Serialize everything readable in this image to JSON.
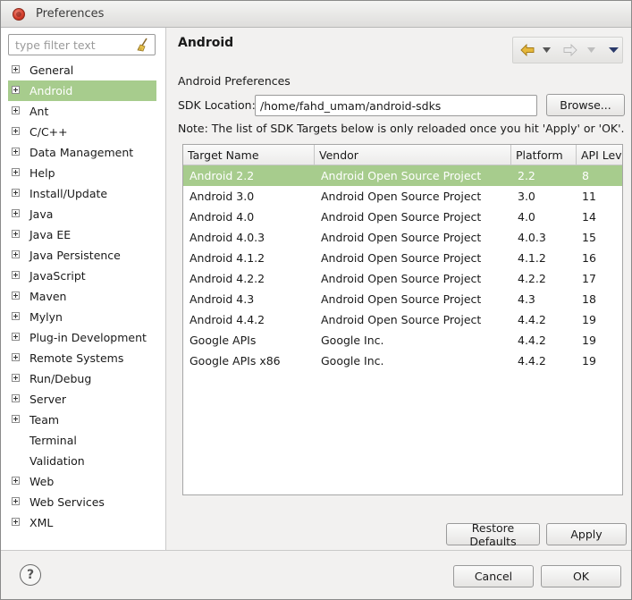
{
  "window": {
    "title": "Preferences"
  },
  "filter": {
    "placeholder": "type filter text"
  },
  "tree": [
    {
      "label": "General",
      "expandable": true
    },
    {
      "label": "Android",
      "expandable": true,
      "selected": true
    },
    {
      "label": "Ant",
      "expandable": true
    },
    {
      "label": "C/C++",
      "expandable": true
    },
    {
      "label": "Data Management",
      "expandable": true
    },
    {
      "label": "Help",
      "expandable": true
    },
    {
      "label": "Install/Update",
      "expandable": true
    },
    {
      "label": "Java",
      "expandable": true
    },
    {
      "label": "Java EE",
      "expandable": true
    },
    {
      "label": "Java Persistence",
      "expandable": true
    },
    {
      "label": "JavaScript",
      "expandable": true
    },
    {
      "label": "Maven",
      "expandable": true
    },
    {
      "label": "Mylyn",
      "expandable": true
    },
    {
      "label": "Plug-in Development",
      "expandable": true
    },
    {
      "label": "Remote Systems",
      "expandable": true
    },
    {
      "label": "Run/Debug",
      "expandable": true
    },
    {
      "label": "Server",
      "expandable": true
    },
    {
      "label": "Team",
      "expandable": true
    },
    {
      "label": "Terminal",
      "expandable": false
    },
    {
      "label": "Validation",
      "expandable": false
    },
    {
      "label": "Web",
      "expandable": true
    },
    {
      "label": "Web Services",
      "expandable": true
    },
    {
      "label": "XML",
      "expandable": true
    }
  ],
  "page": {
    "title": "Android",
    "section_label": "Android Preferences",
    "sdk_label": "SDK Location:",
    "sdk_value": "/home/fahd_umam/android-sdks",
    "browse_label": "Browse...",
    "note": "Note: The list of SDK Targets below is only reloaded once you hit 'Apply' or 'OK'."
  },
  "table": {
    "columns": [
      "Target Name",
      "Vendor",
      "Platform",
      "API Lev"
    ],
    "rows": [
      [
        "Android 2.2",
        "Android Open Source Project",
        "2.2",
        "8"
      ],
      [
        "Android 3.0",
        "Android Open Source Project",
        "3.0",
        "11"
      ],
      [
        "Android 4.0",
        "Android Open Source Project",
        "4.0",
        "14"
      ],
      [
        "Android 4.0.3",
        "Android Open Source Project",
        "4.0.3",
        "15"
      ],
      [
        "Android 4.1.2",
        "Android Open Source Project",
        "4.1.2",
        "16"
      ],
      [
        "Android 4.2.2",
        "Android Open Source Project",
        "4.2.2",
        "17"
      ],
      [
        "Android 4.3",
        "Android Open Source Project",
        "4.3",
        "18"
      ],
      [
        "Android 4.4.2",
        "Android Open Source Project",
        "4.4.2",
        "19"
      ],
      [
        "Google APIs",
        "Google Inc.",
        "4.4.2",
        "19"
      ],
      [
        "Google APIs x86",
        "Google Inc.",
        "4.4.2",
        "19"
      ]
    ],
    "selected_row": 0
  },
  "buttons": {
    "restore_defaults": "Restore Defaults",
    "apply": "Apply",
    "cancel": "Cancel",
    "ok": "OK"
  },
  "icons": {
    "close": "close-icon",
    "clear_filter": "broom-icon",
    "back": "back-arrow-icon",
    "back_menu": "dropdown-triangle-icon",
    "forward": "forward-arrow-icon",
    "forward_menu": "dropdown-triangle-icon",
    "view_menu": "view-menu-icon",
    "help": "help-icon"
  },
  "colors": {
    "selection": "#a7cc8d",
    "back_arrow": "#e0b23a",
    "close_button": "#d13a28"
  }
}
